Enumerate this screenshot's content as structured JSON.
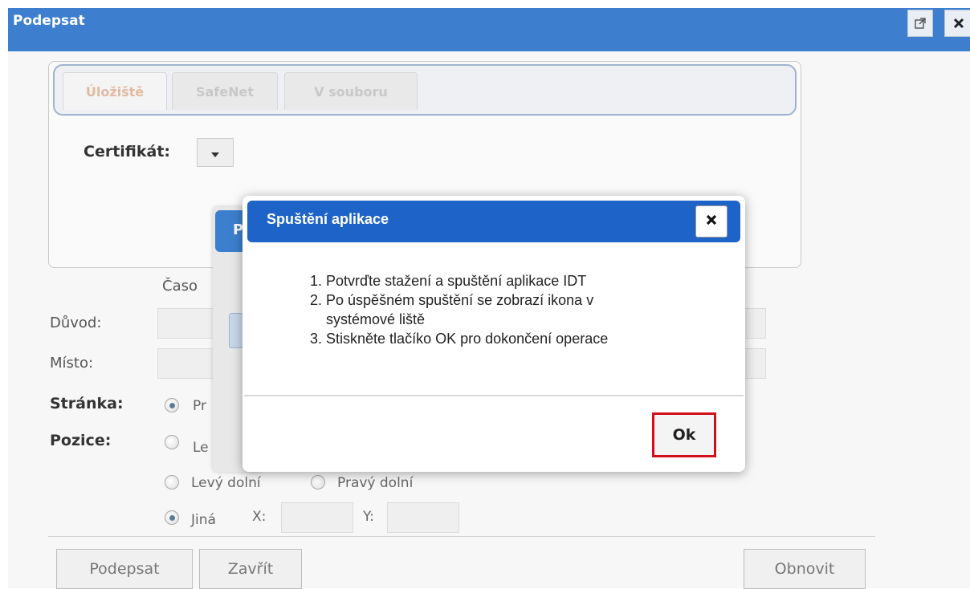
{
  "window": {
    "title": "Podepsat",
    "popout_icon": "external-window-icon",
    "close_icon": "close-icon"
  },
  "tabs": [
    {
      "label": "Úložiště",
      "active": true
    },
    {
      "label": "SafeNet",
      "active": false
    },
    {
      "label": "V souboru",
      "active": false
    }
  ],
  "certificate_label": "Certifikát:",
  "partial_label_time": "Časo",
  "form": {
    "reason_label": "Důvod:",
    "place_label": "Místo:",
    "page_label": "Stránka:",
    "page_option_partial": "Pr",
    "position_label": "Pozice:",
    "position_partial": "Le",
    "options": {
      "bottom_left": "Levý dolní",
      "bottom_right": "Pravý dolní",
      "other": "Jiná",
      "x_label": "X:",
      "y_label": "Y:"
    }
  },
  "buttons": {
    "sign": "Podepsat",
    "close": "Zavřít",
    "refresh": "Obnovit"
  },
  "background_dialog": {
    "title_partial": "P"
  },
  "modal": {
    "title": "Spuštění aplikace",
    "steps": [
      "1. Potvrďte stažení a spuštění aplikace IDT",
      "2. Po úspěšném spuštění se zobrazí ikona v",
      "systémové liště",
      "3. Stiskněte tlačíko OK pro dokončení operace"
    ],
    "ok_label": "Ok"
  },
  "colors": {
    "titlebar": "#3d7fce",
    "modal_titlebar": "#1e64c8",
    "ok_highlight": "#d10f1a"
  }
}
